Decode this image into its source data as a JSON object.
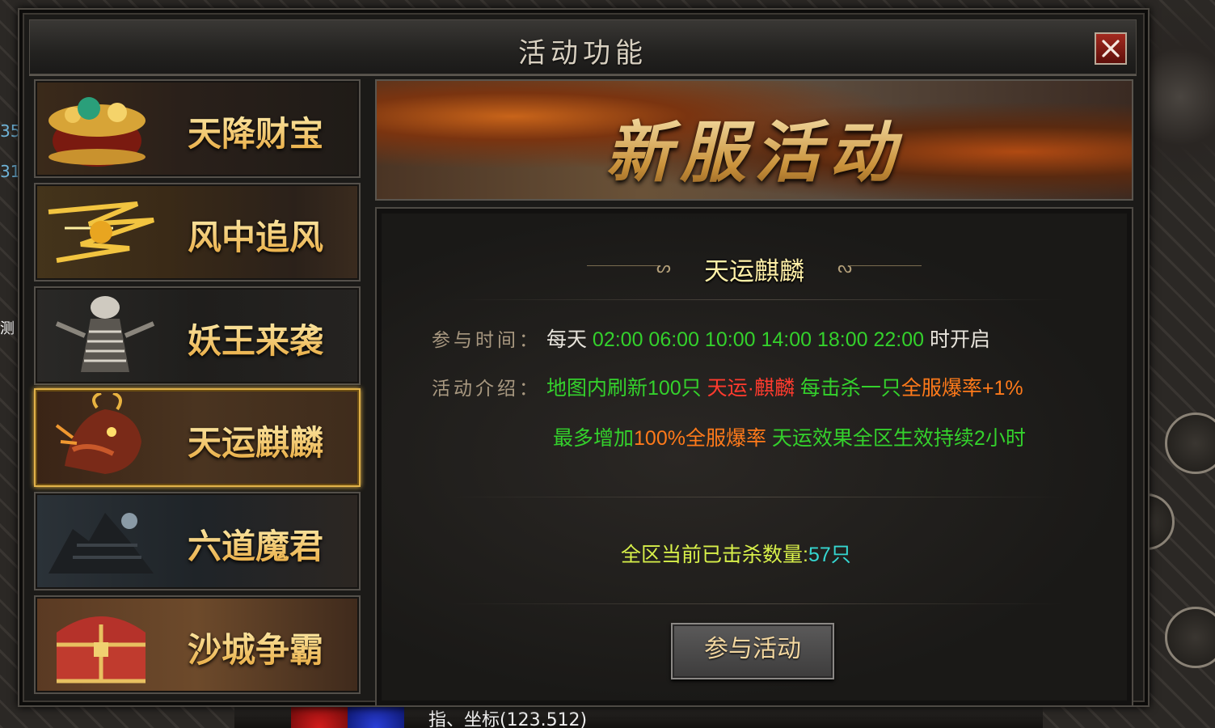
{
  "background": {
    "left_numbers": [
      "35",
      "31"
    ],
    "left_char": "测",
    "coord_text": "指、坐标(123.512)"
  },
  "window": {
    "title": "活动功能"
  },
  "menu": [
    {
      "label": "天降财宝",
      "icon": "treasure-pot-icon"
    },
    {
      "label": "风中追风",
      "icon": "wind-runner-icon"
    },
    {
      "label": "妖王来袭",
      "icon": "skeleton-king-icon"
    },
    {
      "label": "天运麒麟",
      "icon": "qilin-icon"
    },
    {
      "label": "六道魔君",
      "icon": "demon-lord-icon"
    },
    {
      "label": "沙城争霸",
      "icon": "treasure-chest-icon"
    }
  ],
  "selected_menu_index": 3,
  "banner": {
    "title": "新服活动"
  },
  "detail": {
    "section_title": "天运麒麟",
    "time_label": "参与时间：",
    "time_prefix": "每天",
    "time_values": "02:00 06:00 10:00 14:00 18:00 22:00",
    "time_suffix": "时开启",
    "intro_label": "活动介绍：",
    "intro_line1": {
      "a": "地图内刷新100只",
      "b": "天运·麒麟",
      "c": "每击杀一只",
      "d": "全服爆率+1%"
    },
    "intro_line2": {
      "a": "最多增加",
      "b": "100%全服爆率",
      "c": "天运效果全区生效持续2小时"
    },
    "kill_count_label": "全区当前已击杀数量:",
    "kill_count_value": "57只",
    "join_button": "参与活动"
  },
  "colors": {
    "green": "#34d12c",
    "red": "#ff3b2e",
    "orange": "#ff7a1a",
    "cyan": "#35d6d0",
    "gold": "#f3c65a"
  }
}
